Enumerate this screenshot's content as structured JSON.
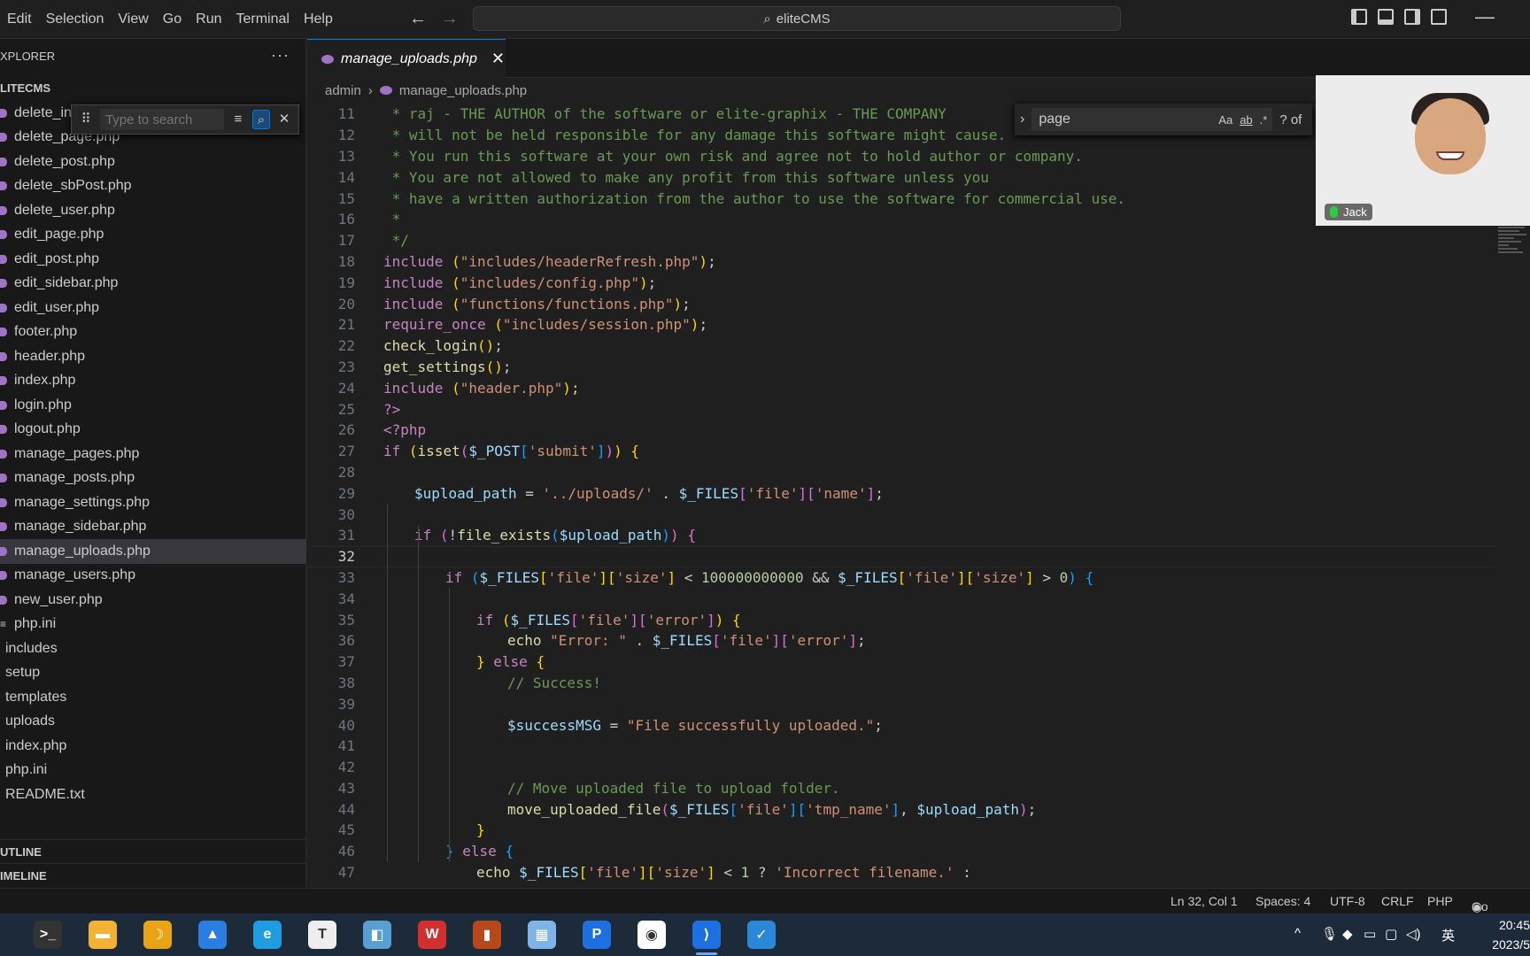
{
  "menu": [
    "Edit",
    "Selection",
    "View",
    "Go",
    "Run",
    "Terminal",
    "Help"
  ],
  "command_center": {
    "text": "eliteCMS"
  },
  "explorer": {
    "title": "XPLORER",
    "root": "LITECMS",
    "filter_placeholder": "Type to search",
    "files": [
      {
        "name": "delete_in",
        "kind": "php"
      },
      {
        "name": "delete_page.php",
        "kind": "php"
      },
      {
        "name": "delete_post.php",
        "kind": "php"
      },
      {
        "name": "delete_sbPost.php",
        "kind": "php"
      },
      {
        "name": "delete_user.php",
        "kind": "php"
      },
      {
        "name": "edit_page.php",
        "kind": "php"
      },
      {
        "name": "edit_post.php",
        "kind": "php"
      },
      {
        "name": "edit_sidebar.php",
        "kind": "php"
      },
      {
        "name": "edit_user.php",
        "kind": "php"
      },
      {
        "name": "footer.php",
        "kind": "php"
      },
      {
        "name": "header.php",
        "kind": "php"
      },
      {
        "name": "index.php",
        "kind": "php"
      },
      {
        "name": "login.php",
        "kind": "php"
      },
      {
        "name": "logout.php",
        "kind": "php"
      },
      {
        "name": "manage_pages.php",
        "kind": "php"
      },
      {
        "name": "manage_posts.php",
        "kind": "php"
      },
      {
        "name": "manage_settings.php",
        "kind": "php"
      },
      {
        "name": "manage_sidebar.php",
        "kind": "php"
      },
      {
        "name": "manage_uploads.php",
        "kind": "php",
        "selected": true
      },
      {
        "name": "manage_users.php",
        "kind": "php"
      },
      {
        "name": "new_user.php",
        "kind": "php"
      },
      {
        "name": "php.ini",
        "kind": "ini"
      },
      {
        "name": "includes",
        "kind": "folder"
      },
      {
        "name": "setup",
        "kind": "folder"
      },
      {
        "name": "templates",
        "kind": "folder"
      },
      {
        "name": "uploads",
        "kind": "folder"
      },
      {
        "name": "index.php",
        "kind": "root"
      },
      {
        "name": "php.ini",
        "kind": "root"
      },
      {
        "name": "README.txt",
        "kind": "root"
      }
    ],
    "outline": "UTLINE",
    "timeline": "IMELINE"
  },
  "tab": {
    "label": "manage_uploads.php"
  },
  "breadcrumb": {
    "folder": "admin",
    "file": "manage_uploads.php"
  },
  "find": {
    "query": "page",
    "count": "? of",
    "opt_case": "Aa",
    "opt_word": "ab",
    "opt_regex": ".*"
  },
  "code": {
    "current_line": 32,
    "lines": [
      {
        "n": 11,
        "indent": 0,
        "segs": [
          [
            "cm",
            " * raj - THE AUTHOR of the software or elite-graphix - THE COMPANY"
          ]
        ]
      },
      {
        "n": 12,
        "indent": 0,
        "segs": [
          [
            "cm",
            " * will not be held responsible for any damage this software might cause."
          ]
        ]
      },
      {
        "n": 13,
        "indent": 0,
        "segs": [
          [
            "cm",
            " * You run this software at your own risk and agree not to hold author or company."
          ]
        ]
      },
      {
        "n": 14,
        "indent": 0,
        "segs": [
          [
            "cm",
            " * You are not allowed to make any profit from this software unless you"
          ]
        ]
      },
      {
        "n": 15,
        "indent": 0,
        "segs": [
          [
            "cm",
            " * have a written authorization from the author to use the software for commercial use."
          ]
        ]
      },
      {
        "n": 16,
        "indent": 0,
        "segs": [
          [
            "cm",
            " *"
          ]
        ]
      },
      {
        "n": 17,
        "indent": 0,
        "segs": [
          [
            "cm",
            " */"
          ]
        ]
      },
      {
        "n": 18,
        "indent": 0,
        "segs": [
          [
            "kw",
            "include "
          ],
          [
            "b1",
            "("
          ],
          [
            "st",
            "\"includes/headerRefresh.php\""
          ],
          [
            "b1",
            ")"
          ],
          [
            "pl",
            ";"
          ]
        ]
      },
      {
        "n": 19,
        "indent": 0,
        "segs": [
          [
            "kw",
            "include "
          ],
          [
            "b1",
            "("
          ],
          [
            "st",
            "\"includes/config.php\""
          ],
          [
            "b1",
            ")"
          ],
          [
            "pl",
            ";"
          ]
        ]
      },
      {
        "n": 20,
        "indent": 0,
        "segs": [
          [
            "kw",
            "include "
          ],
          [
            "b1",
            "("
          ],
          [
            "st",
            "\"functions/functions.php\""
          ],
          [
            "b1",
            ")"
          ],
          [
            "pl",
            ";"
          ]
        ]
      },
      {
        "n": 21,
        "indent": 0,
        "segs": [
          [
            "kw",
            "require_once "
          ],
          [
            "b1",
            "("
          ],
          [
            "st",
            "\"includes/session.php\""
          ],
          [
            "b1",
            ")"
          ],
          [
            "pl",
            ";"
          ]
        ]
      },
      {
        "n": 22,
        "indent": 0,
        "segs": [
          [
            "fn",
            "check_login"
          ],
          [
            "b1",
            "()"
          ],
          [
            "pl",
            ";"
          ]
        ]
      },
      {
        "n": 23,
        "indent": 0,
        "segs": [
          [
            "fn",
            "get_settings"
          ],
          [
            "b1",
            "()"
          ],
          [
            "pl",
            ";"
          ]
        ]
      },
      {
        "n": 24,
        "indent": 0,
        "segs": [
          [
            "kw",
            "include "
          ],
          [
            "b1",
            "("
          ],
          [
            "st",
            "\"header.php\""
          ],
          [
            "b1",
            ")"
          ],
          [
            "pl",
            ";"
          ]
        ]
      },
      {
        "n": 25,
        "indent": 0,
        "segs": [
          [
            "kw",
            "?>"
          ]
        ]
      },
      {
        "n": 26,
        "indent": 0,
        "segs": [
          [
            "kw",
            "<?php"
          ]
        ]
      },
      {
        "n": 27,
        "indent": 0,
        "segs": [
          [
            "kw",
            "if "
          ],
          [
            "b1",
            "("
          ],
          [
            "fn",
            "isset"
          ],
          [
            "b2",
            "("
          ],
          [
            "vr",
            "$_POST"
          ],
          [
            "b3",
            "["
          ],
          [
            "st",
            "'submit'"
          ],
          [
            "b3",
            "]"
          ],
          [
            "b2",
            ")"
          ],
          [
            "b1",
            ")"
          ],
          [
            "pl",
            " "
          ],
          [
            "b1",
            "{"
          ]
        ]
      },
      {
        "n": 28,
        "indent": 0,
        "segs": []
      },
      {
        "n": 29,
        "indent": 1,
        "segs": [
          [
            "vr",
            "$upload_path"
          ],
          [
            "pl",
            " = "
          ],
          [
            "st",
            "'../uploads/'"
          ],
          [
            "pl",
            " . "
          ],
          [
            "vr",
            "$_FILES"
          ],
          [
            "b2",
            "["
          ],
          [
            "st",
            "'file'"
          ],
          [
            "b2",
            "]["
          ],
          [
            "st",
            "'name'"
          ],
          [
            "b2",
            "]"
          ],
          [
            "pl",
            ";"
          ]
        ]
      },
      {
        "n": 30,
        "indent": 0,
        "segs": []
      },
      {
        "n": 31,
        "indent": 1,
        "segs": [
          [
            "kw",
            "if "
          ],
          [
            "b2",
            "("
          ],
          [
            "pl",
            "!"
          ],
          [
            "fn",
            "file_exists"
          ],
          [
            "b3",
            "("
          ],
          [
            "vr",
            "$upload_path"
          ],
          [
            "b3",
            ")"
          ],
          [
            "b2",
            ")"
          ],
          [
            "pl",
            " "
          ],
          [
            "b2",
            "{"
          ]
        ]
      },
      {
        "n": 32,
        "indent": 0,
        "segs": []
      },
      {
        "n": 33,
        "indent": 2,
        "segs": [
          [
            "kw",
            "if "
          ],
          [
            "b3",
            "("
          ],
          [
            "vr",
            "$_FILES"
          ],
          [
            "b1",
            "["
          ],
          [
            "st",
            "'file'"
          ],
          [
            "b1",
            "]["
          ],
          [
            "st",
            "'size'"
          ],
          [
            "b1",
            "]"
          ],
          [
            "pl",
            " < "
          ],
          [
            "nm",
            "100000000000"
          ],
          [
            "pl",
            " && "
          ],
          [
            "vr",
            "$_FILES"
          ],
          [
            "b1",
            "["
          ],
          [
            "st",
            "'file'"
          ],
          [
            "b1",
            "]["
          ],
          [
            "st",
            "'size'"
          ],
          [
            "b1",
            "]"
          ],
          [
            "pl",
            " > "
          ],
          [
            "nm",
            "0"
          ],
          [
            "b3",
            ")"
          ],
          [
            "pl",
            " "
          ],
          [
            "b3",
            "{"
          ]
        ]
      },
      {
        "n": 34,
        "indent": 0,
        "segs": []
      },
      {
        "n": 35,
        "indent": 3,
        "segs": [
          [
            "kw",
            "if "
          ],
          [
            "b1",
            "("
          ],
          [
            "vr",
            "$_FILES"
          ],
          [
            "b2",
            "["
          ],
          [
            "st",
            "'file'"
          ],
          [
            "b2",
            "]["
          ],
          [
            "st",
            "'error'"
          ],
          [
            "b2",
            "]"
          ],
          [
            "b1",
            ")"
          ],
          [
            "pl",
            " "
          ],
          [
            "b1",
            "{"
          ]
        ]
      },
      {
        "n": 36,
        "indent": 4,
        "segs": [
          [
            "fn",
            "echo "
          ],
          [
            "st",
            "\"Error: \""
          ],
          [
            "pl",
            " . "
          ],
          [
            "vr",
            "$_FILES"
          ],
          [
            "b2",
            "["
          ],
          [
            "st",
            "'file'"
          ],
          [
            "b2",
            "]["
          ],
          [
            "st",
            "'error'"
          ],
          [
            "b2",
            "]"
          ],
          [
            "pl",
            ";"
          ]
        ]
      },
      {
        "n": 37,
        "indent": 3,
        "segs": [
          [
            "b1",
            "}"
          ],
          [
            "kw",
            " else "
          ],
          [
            "b1",
            "{"
          ]
        ]
      },
      {
        "n": 38,
        "indent": 4,
        "segs": [
          [
            "cm",
            "// Success!"
          ]
        ]
      },
      {
        "n": 39,
        "indent": 0,
        "segs": []
      },
      {
        "n": 40,
        "indent": 4,
        "segs": [
          [
            "vr",
            "$successMSG"
          ],
          [
            "pl",
            " = "
          ],
          [
            "st",
            "\"File successfully uploaded.\""
          ],
          [
            "pl",
            ";"
          ]
        ]
      },
      {
        "n": 41,
        "indent": 0,
        "segs": []
      },
      {
        "n": 42,
        "indent": 0,
        "segs": []
      },
      {
        "n": 43,
        "indent": 4,
        "segs": [
          [
            "cm",
            "// Move uploaded file to upload folder."
          ]
        ]
      },
      {
        "n": 44,
        "indent": 4,
        "segs": [
          [
            "fn",
            "move_uploaded_file"
          ],
          [
            "b2",
            "("
          ],
          [
            "vr",
            "$_FILES"
          ],
          [
            "b3",
            "["
          ],
          [
            "st",
            "'file'"
          ],
          [
            "b3",
            "]["
          ],
          [
            "st",
            "'tmp_name'"
          ],
          [
            "b3",
            "]"
          ],
          [
            "pl",
            ", "
          ],
          [
            "vr",
            "$upload_path"
          ],
          [
            "b2",
            ")"
          ],
          [
            "pl",
            ";"
          ]
        ]
      },
      {
        "n": 45,
        "indent": 3,
        "segs": [
          [
            "b1",
            "}"
          ]
        ]
      },
      {
        "n": 46,
        "indent": 2,
        "segs": [
          [
            "b3",
            "}"
          ],
          [
            "kw",
            " else "
          ],
          [
            "b3",
            "{"
          ]
        ]
      },
      {
        "n": 47,
        "indent": 3,
        "segs": [
          [
            "fn",
            "echo "
          ],
          [
            "vr",
            "$_FILES"
          ],
          [
            "b1",
            "["
          ],
          [
            "st",
            "'file'"
          ],
          [
            "b1",
            "]["
          ],
          [
            "st",
            "'size'"
          ],
          [
            "b1",
            "]"
          ],
          [
            "pl",
            " < "
          ],
          [
            "nm",
            "1"
          ],
          [
            "pl",
            " ? "
          ],
          [
            "st",
            "'Incorrect filename.'"
          ],
          [
            "pl",
            " :"
          ]
        ]
      }
    ]
  },
  "webcam": {
    "name": "Jack"
  },
  "status": {
    "position": "Ln 32, Col 1",
    "spaces": "Spaces: 4",
    "encoding": "UTF-8",
    "eol": "CRLF",
    "language": "PHP",
    "golive": "Go Live"
  },
  "taskbar": {
    "apps": [
      "terminal",
      "file-explorer",
      "app-3",
      "app-4",
      "edge",
      "typora",
      "app-7",
      "wps",
      "app-9",
      "app-10",
      "app-11",
      "chrome",
      "vscode",
      "app-14"
    ],
    "ime": "英",
    "time": "20:45",
    "date": "2023/5"
  }
}
